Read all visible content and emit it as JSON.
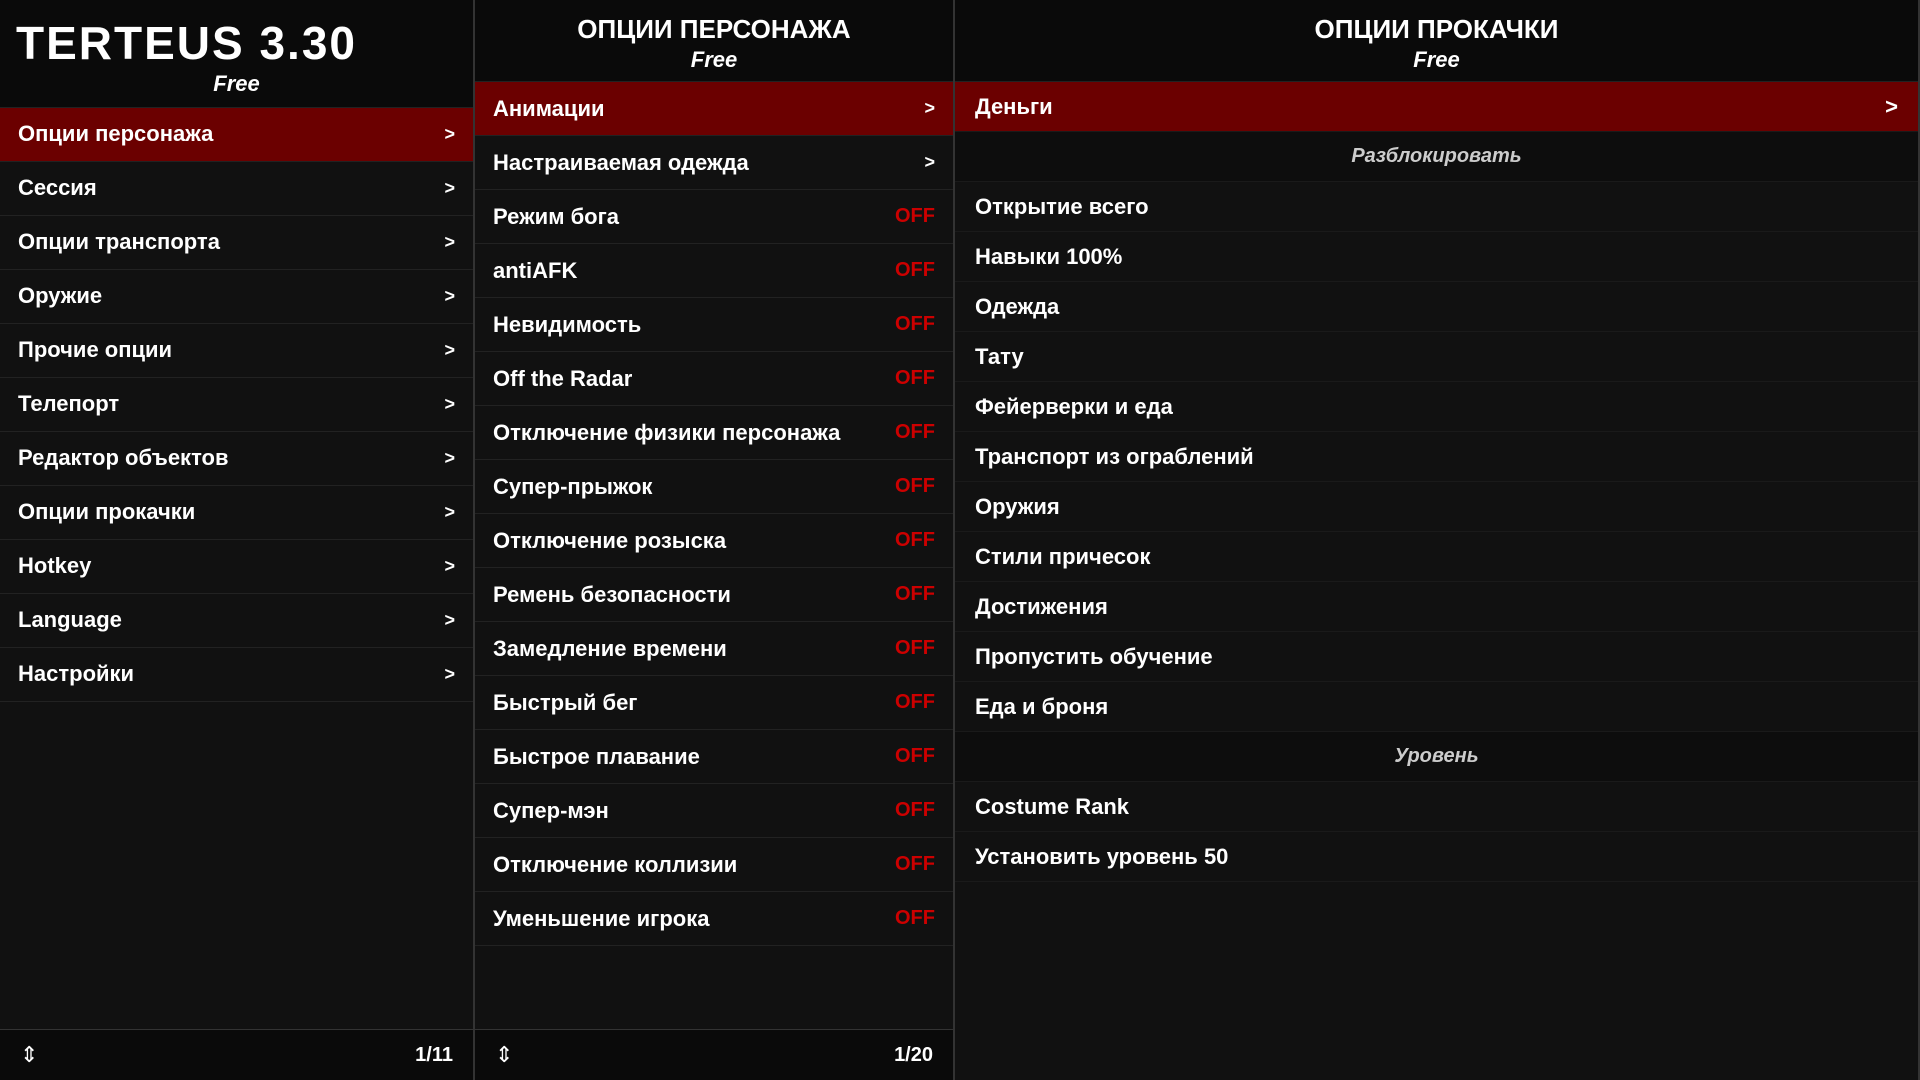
{
  "left": {
    "title": "teRteus 3.30",
    "free_label": "Free",
    "items": [
      {
        "label": "Опции персонажа",
        "arrow": ">",
        "active": true
      },
      {
        "label": "Сессия",
        "arrow": ">",
        "active": false
      },
      {
        "label": "Опции транспорта",
        "arrow": ">",
        "active": false
      },
      {
        "label": "Оружие",
        "arrow": ">",
        "active": false
      },
      {
        "label": "Прочие опции",
        "arrow": ">",
        "active": false
      },
      {
        "label": "Телепорт",
        "arrow": ">",
        "active": false
      },
      {
        "label": "Редактор объектов",
        "arrow": ">",
        "active": false
      },
      {
        "label": "Опции прокачки",
        "arrow": ">",
        "active": false
      },
      {
        "label": "Hotkey",
        "arrow": ">",
        "active": false
      },
      {
        "label": "Language",
        "arrow": ">",
        "active": false
      },
      {
        "label": "Настройки",
        "arrow": ">",
        "active": false
      }
    ],
    "page": "1/11"
  },
  "mid": {
    "title": "Опции персонажа",
    "free_label": "Free",
    "items": [
      {
        "label": "Анимации",
        "status": ">",
        "type": "arrow",
        "active": true
      },
      {
        "label": "Настраиваемая одежда",
        "status": ">",
        "type": "arrow",
        "active": false
      },
      {
        "label": "Режим бога",
        "status": "OFF",
        "type": "toggle",
        "active": false
      },
      {
        "label": "antiAFK",
        "status": "OFF",
        "type": "toggle",
        "active": false
      },
      {
        "label": "Невидимость",
        "status": "OFF",
        "type": "toggle",
        "active": false
      },
      {
        "label": "Off the Radar",
        "status": "OFF",
        "type": "toggle",
        "active": false
      },
      {
        "label": "Отключение физики персонажа",
        "status": "OFF",
        "type": "toggle",
        "active": false
      },
      {
        "label": "Супер-прыжок",
        "status": "OFF",
        "type": "toggle",
        "active": false
      },
      {
        "label": "Отключение розыска",
        "status": "OFF",
        "type": "toggle",
        "active": false
      },
      {
        "label": "Ремень безопасности",
        "status": "OFF",
        "type": "toggle",
        "active": false
      },
      {
        "label": "Замедление времени",
        "status": "OFF",
        "type": "toggle",
        "active": false
      },
      {
        "label": "Быстрый бег",
        "status": "OFF",
        "type": "toggle",
        "active": false
      },
      {
        "label": "Быстрое плавание",
        "status": "OFF",
        "type": "toggle",
        "active": false
      },
      {
        "label": "Супер-мэн",
        "status": "OFF",
        "type": "toggle",
        "active": false
      },
      {
        "label": "Отключение коллизии",
        "status": "OFF",
        "type": "toggle",
        "active": false
      },
      {
        "label": "Уменьшение игрока",
        "status": "OFF",
        "type": "toggle",
        "active": false
      }
    ],
    "page": "1/20"
  },
  "right": {
    "title": "Опции прокачки",
    "free_label": "Free",
    "items": [
      {
        "label": "Деньги",
        "status": ">",
        "type": "arrow",
        "active": true
      },
      {
        "label": "Разблокировать",
        "type": "section",
        "active": false
      },
      {
        "label": "Открытие всего",
        "type": "plain",
        "active": false
      },
      {
        "label": "Навыки 100%",
        "type": "plain",
        "active": false
      },
      {
        "label": "Одежда",
        "type": "plain",
        "active": false
      },
      {
        "label": "Тату",
        "type": "plain",
        "active": false
      },
      {
        "label": "Фейерверки и еда",
        "type": "plain",
        "active": false
      },
      {
        "label": "Транспорт из ограблений",
        "type": "plain",
        "active": false
      },
      {
        "label": "Оружия",
        "type": "plain",
        "active": false
      },
      {
        "label": "Стили причесок",
        "type": "plain",
        "active": false
      },
      {
        "label": "Достижения",
        "type": "plain",
        "active": false
      },
      {
        "label": "Пропустить обучение",
        "type": "plain",
        "active": false
      },
      {
        "label": "Еда и броня",
        "type": "plain",
        "active": false
      },
      {
        "label": "Уровень",
        "type": "section",
        "active": false
      },
      {
        "label": "Costume Rank",
        "type": "plain",
        "active": false
      },
      {
        "label": "Установить уровень 50",
        "type": "plain",
        "active": false
      }
    ]
  }
}
